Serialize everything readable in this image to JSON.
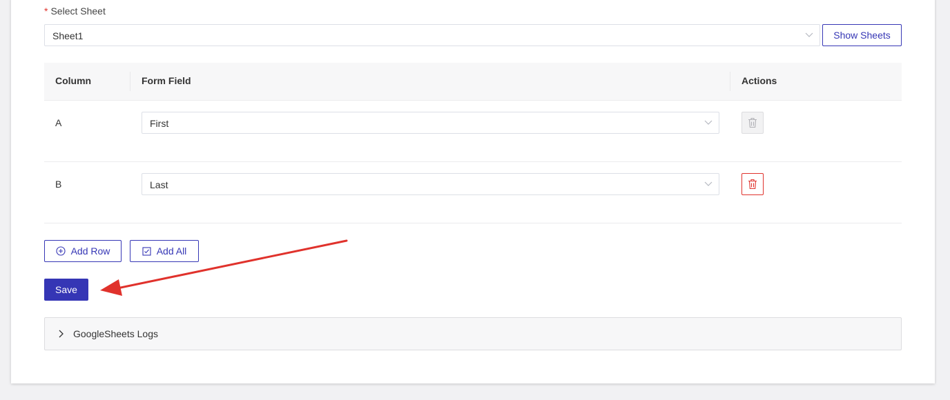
{
  "sheet": {
    "label": "Select Sheet",
    "required_mark": "*",
    "selected": "Sheet1",
    "show_sheets_label": "Show Sheets"
  },
  "table": {
    "headers": {
      "column": "Column",
      "form_field": "Form Field",
      "actions": "Actions"
    },
    "rows": [
      {
        "column": "A",
        "field": "First",
        "delete_enabled": false
      },
      {
        "column": "B",
        "field": "Last",
        "delete_enabled": true
      }
    ]
  },
  "buttons": {
    "add_row": "Add Row",
    "add_all": "Add All",
    "save": "Save"
  },
  "logs": {
    "label": "GoogleSheets Logs"
  },
  "colors": {
    "accent": "#3536b5",
    "danger": "#e0322c",
    "annotation_arrow": "#e0322c"
  }
}
